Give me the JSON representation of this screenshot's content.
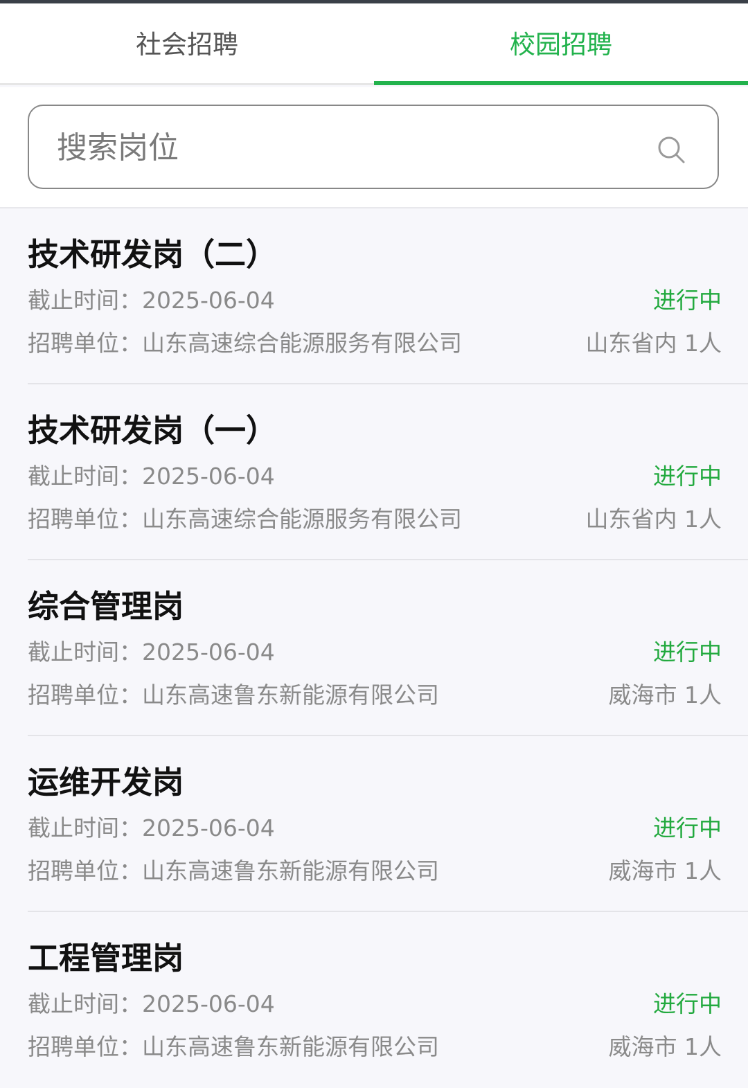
{
  "tabs": [
    {
      "label": "社会招聘",
      "active": false
    },
    {
      "label": "校园招聘",
      "active": true
    }
  ],
  "search": {
    "placeholder": "搜索岗位",
    "value": "",
    "icon": "search-icon"
  },
  "labels": {
    "deadline": "截止时间：",
    "org": "招聘单位："
  },
  "colors": {
    "accent": "#22b24c",
    "status": "#22a93e"
  },
  "jobs": [
    {
      "title": "技术研发岗（二）",
      "deadline": "2025-06-04",
      "status": "进行中",
      "org": "山东高速综合能源服务有限公司",
      "location": "山东省内",
      "count": "1人"
    },
    {
      "title": "技术研发岗（一）",
      "deadline": "2025-06-04",
      "status": "进行中",
      "org": "山东高速综合能源服务有限公司",
      "location": "山东省内",
      "count": "1人"
    },
    {
      "title": "综合管理岗",
      "deadline": "2025-06-04",
      "status": "进行中",
      "org": "山东高速鲁东新能源有限公司",
      "location": "威海市",
      "count": "1人"
    },
    {
      "title": "运维开发岗",
      "deadline": "2025-06-04",
      "status": "进行中",
      "org": "山东高速鲁东新能源有限公司",
      "location": "威海市",
      "count": "1人"
    },
    {
      "title": "工程管理岗",
      "deadline": "2025-06-04",
      "status": "进行中",
      "org": "山东高速鲁东新能源有限公司",
      "location": "威海市",
      "count": "1人"
    }
  ]
}
